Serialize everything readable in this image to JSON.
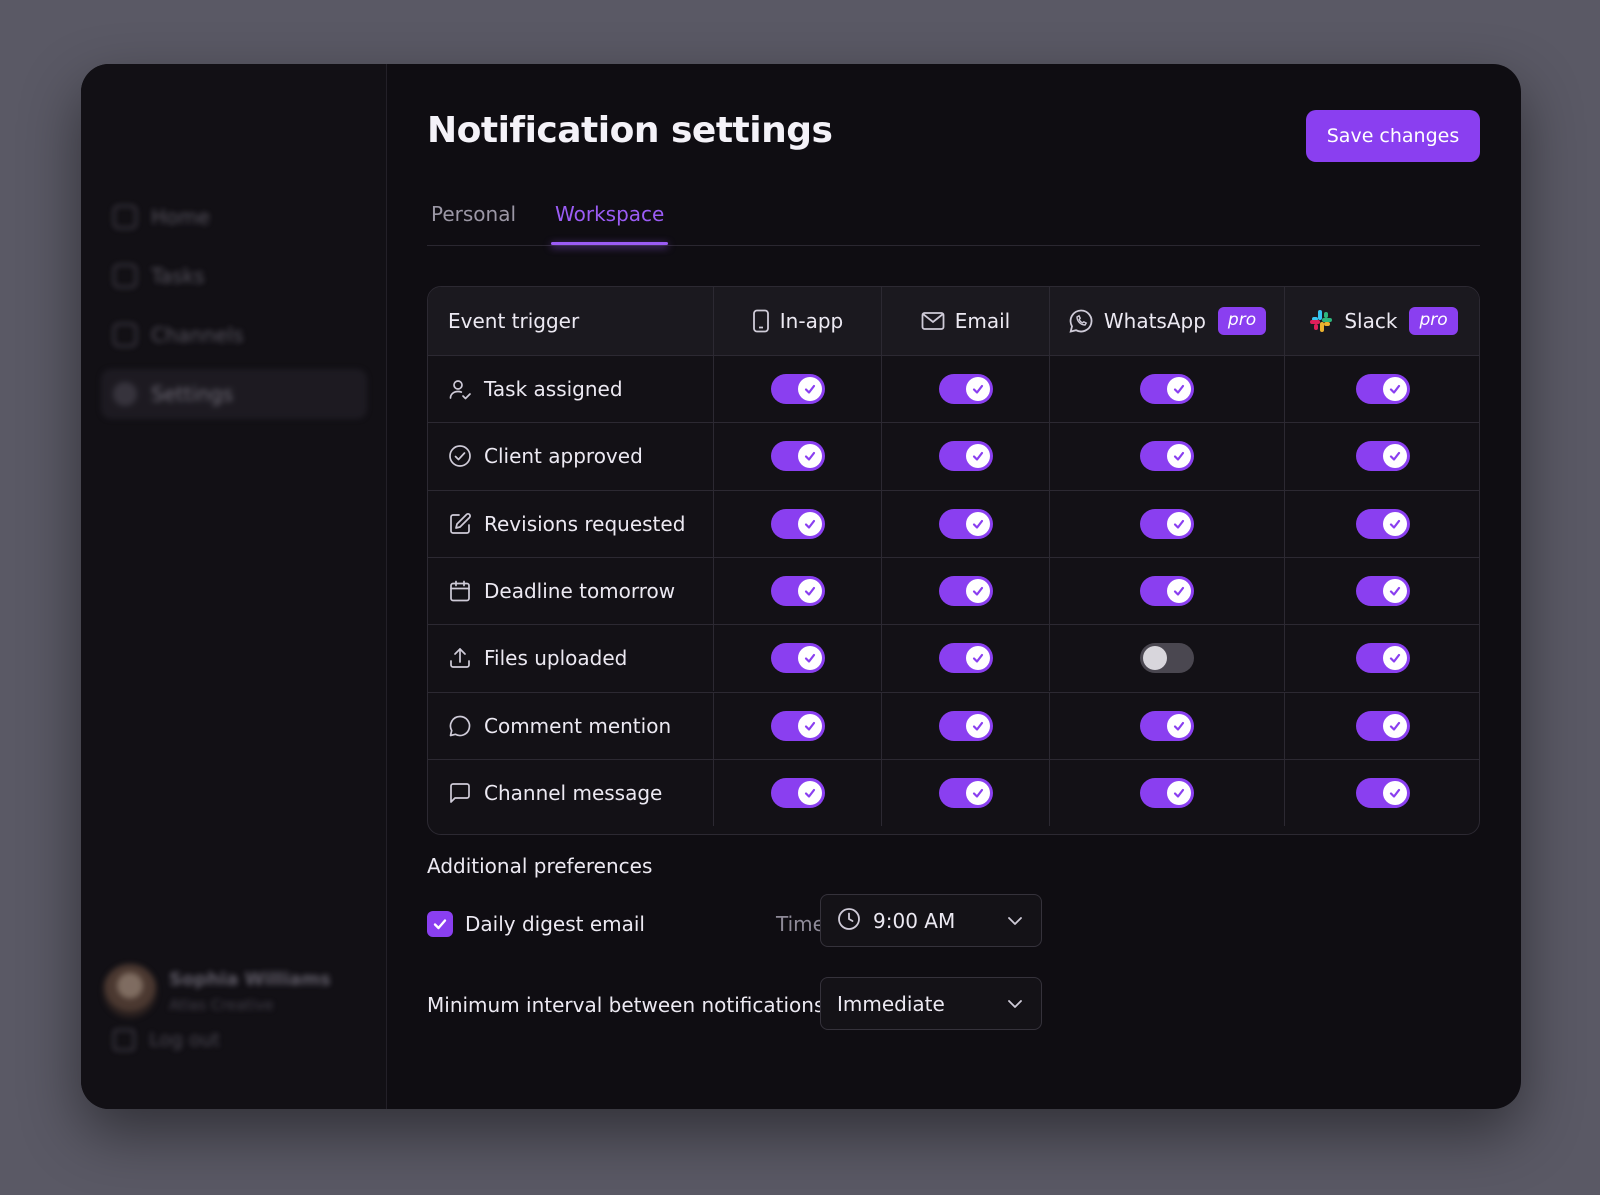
{
  "sidebar": {
    "nav": [
      "Home",
      "Tasks",
      "Channels",
      "Settings"
    ],
    "active": "Settings",
    "user": {
      "name": "Sophia Williams",
      "role": "Atlas Creative"
    },
    "logout": "Log out"
  },
  "page": {
    "title": "Notification settings",
    "save_label": "Save changes"
  },
  "tabs": [
    {
      "label": "Personal",
      "active": false
    },
    {
      "label": "Workspace",
      "active": true
    }
  ],
  "table": {
    "header": {
      "event": "Event trigger",
      "inapp": "In-app",
      "email": "Email",
      "whatsapp": "WhatsApp",
      "slack": "Slack",
      "pro_badge": "pro"
    },
    "rows": [
      {
        "label": "Task assigned",
        "icon": "user-check-icon",
        "inapp": true,
        "email": true,
        "whatsapp": true,
        "slack": true
      },
      {
        "label": "Client approved",
        "icon": "check-circle-icon",
        "inapp": true,
        "email": true,
        "whatsapp": true,
        "slack": true
      },
      {
        "label": "Revisions requested",
        "icon": "edit-icon",
        "inapp": true,
        "email": true,
        "whatsapp": true,
        "slack": true
      },
      {
        "label": "Deadline tomorrow",
        "icon": "calendar-icon",
        "inapp": true,
        "email": true,
        "whatsapp": true,
        "slack": true
      },
      {
        "label": "Files uploaded",
        "icon": "upload-icon",
        "inapp": true,
        "email": true,
        "whatsapp": false,
        "slack": true
      },
      {
        "label": "Comment mention",
        "icon": "comment-icon",
        "inapp": true,
        "email": true,
        "whatsapp": true,
        "slack": true
      },
      {
        "label": "Channel message",
        "icon": "message-square-icon",
        "inapp": true,
        "email": true,
        "whatsapp": true,
        "slack": true
      }
    ]
  },
  "preferences": {
    "title": "Additional preferences",
    "digest_label": "Daily digest email",
    "digest_checked": true,
    "time_label": "Time",
    "time_value": "9:00 AM",
    "interval_label": "Minimum interval between notifications",
    "interval_value": "Immediate"
  },
  "colors": {
    "accent": "#8a3ff0",
    "tab_active": "#9b5cf5",
    "background": "#0f0d12"
  }
}
